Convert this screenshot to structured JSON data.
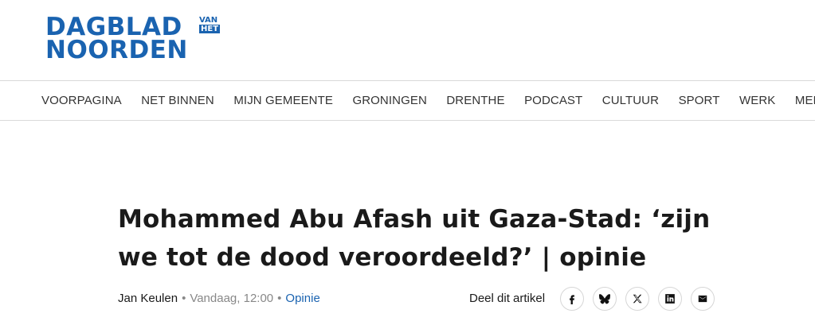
{
  "brand": {
    "line1": "DAGBLAD",
    "line2": "NOORDEN",
    "van": "VAN",
    "het": "HET",
    "color": "#1a63b0"
  },
  "nav": {
    "items": [
      "VOORPAGINA",
      "NET BINNEN",
      "MIJN GEMEENTE",
      "GRONINGEN",
      "DRENTHE",
      "PODCAST",
      "CULTUUR",
      "SPORT",
      "WERK",
      "MENINGEN"
    ]
  },
  "article": {
    "title": "Mohammed Abu Afash uit Gaza-Stad: ‘zijn we tot de dood veroordeeld?’ | opinie",
    "author": "Jan Keulen",
    "separator": "•",
    "time": "Vandaag, 12:00",
    "category": "Opinie"
  },
  "share": {
    "label": "Deel dit artikel",
    "buttons": [
      {
        "icon": "facebook-icon"
      },
      {
        "icon": "bluesky-icon"
      },
      {
        "icon": "x-icon"
      },
      {
        "icon": "linkedin-icon"
      },
      {
        "icon": "email-icon"
      }
    ]
  }
}
